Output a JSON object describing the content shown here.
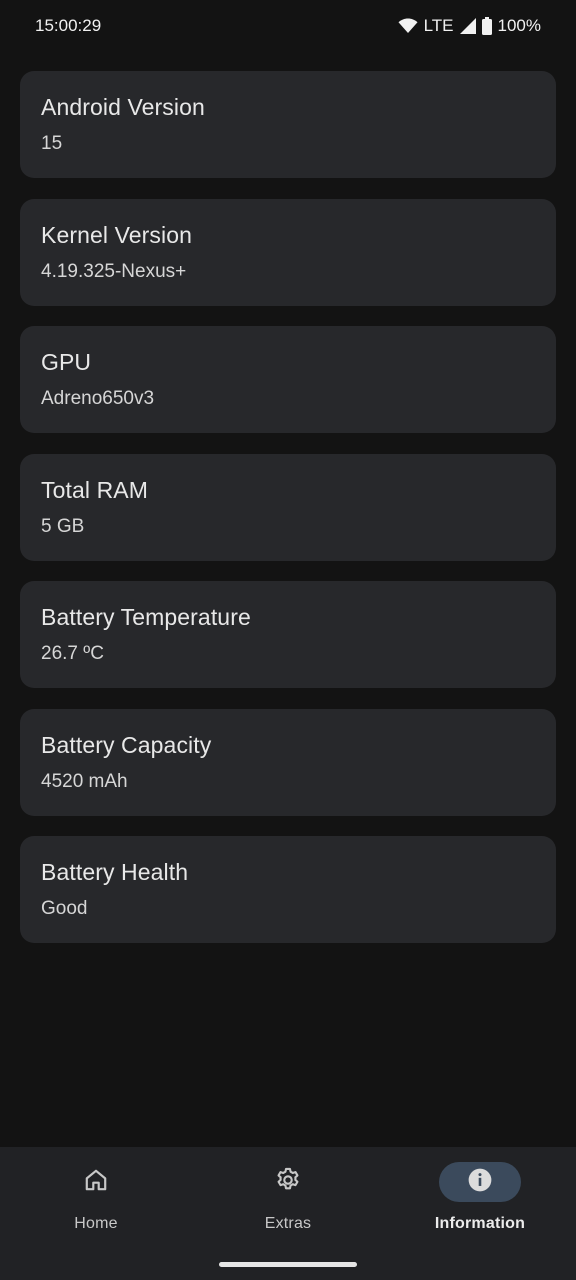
{
  "status_bar": {
    "time": "15:00:29",
    "network": "LTE",
    "battery": "100%",
    "icons": [
      "wifi-icon",
      "cell-signal-icon",
      "battery-icon"
    ]
  },
  "cards": [
    {
      "title": "Android Version",
      "value": "15"
    },
    {
      "title": "Kernel Version",
      "value": "4.19.325-Nexus+"
    },
    {
      "title": "GPU",
      "value": "Adreno650v3"
    },
    {
      "title": "Total RAM",
      "value": "5 GB"
    },
    {
      "title": "Battery Temperature",
      "value": "26.7 ºC"
    },
    {
      "title": "Battery Capacity",
      "value": "4520 mAh"
    },
    {
      "title": "Battery Health",
      "value": "Good"
    }
  ],
  "nav": {
    "items": [
      {
        "label": "Home",
        "icon": "home-icon",
        "active": false
      },
      {
        "label": "Extras",
        "icon": "gear-icon",
        "active": false
      },
      {
        "label": "Information",
        "icon": "info-icon",
        "active": true
      }
    ]
  },
  "colors": {
    "background": "#131313",
    "card": "#27282b",
    "nav_background": "#212225",
    "active_pill": "#3b4a5c"
  }
}
